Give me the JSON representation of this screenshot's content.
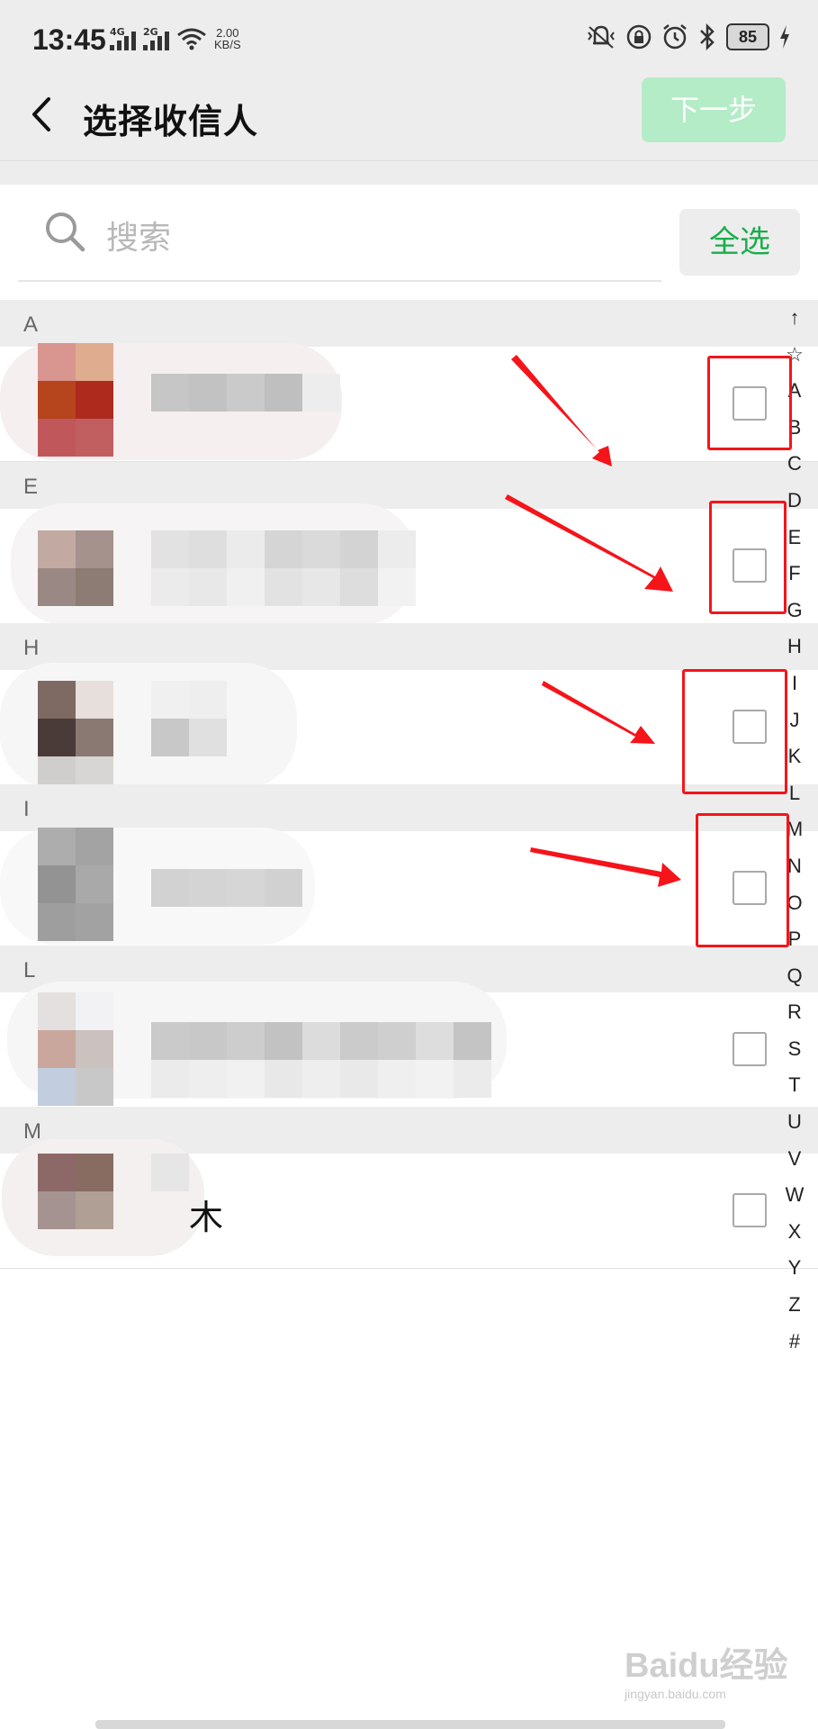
{
  "status_bar": {
    "time": "13:45",
    "network_1": "4G",
    "network_2": "2G",
    "speed_value": "2.00",
    "speed_unit": "KB/S",
    "battery": "85"
  },
  "header": {
    "title": "选择收信人",
    "next_label": "下一步",
    "next_color": "#b3ecc7"
  },
  "search": {
    "placeholder": "搜索",
    "select_all_label": "全选",
    "select_all_color": "#19ad4b"
  },
  "contacts": [
    {
      "section": "A",
      "name": "",
      "checked": false
    },
    {
      "section": "E",
      "name": "",
      "checked": false
    },
    {
      "section": "H",
      "name": "",
      "checked": false
    },
    {
      "section": "I",
      "name": "",
      "checked": false
    },
    {
      "section": "L",
      "name": "",
      "checked": false
    },
    {
      "section": "M",
      "name": "木",
      "checked": false
    }
  ],
  "index_bar": [
    "↑",
    "☆",
    "A",
    "B",
    "C",
    "D",
    "E",
    "F",
    "G",
    "H",
    "I",
    "J",
    "K",
    "L",
    "M",
    "N",
    "O",
    "P",
    "Q",
    "R",
    "S",
    "T",
    "U",
    "V",
    "W",
    "X",
    "Y",
    "Z",
    "#"
  ],
  "watermark": {
    "text": "Baidu经验",
    "sub": "jingyan.baidu.com"
  },
  "annotation_color": "#f5141a"
}
